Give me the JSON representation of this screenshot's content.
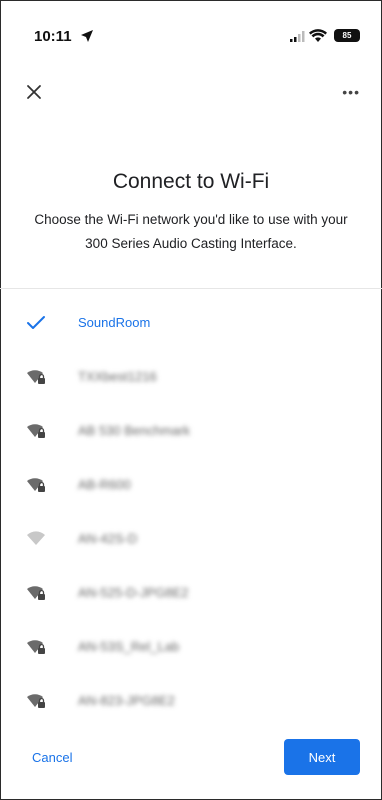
{
  "status_bar": {
    "time": "10:11",
    "battery": "85"
  },
  "header": {
    "title": "Connect to Wi-Fi",
    "subtitle": "Choose the Wi-Fi network you'd like to use with your 300 Series Audio Casting Interface."
  },
  "networks": [
    {
      "name": "SoundRoom",
      "selected": true,
      "icon": "check-icon"
    },
    {
      "name": "TXXbest1216",
      "selected": false,
      "icon": "wifi-locked-icon"
    },
    {
      "name": "AB 530 Benchmark",
      "selected": false,
      "icon": "wifi-locked-icon"
    },
    {
      "name": "AB-R600",
      "selected": false,
      "icon": "wifi-locked-icon"
    },
    {
      "name": "AN-42S-D",
      "selected": false,
      "icon": "wifi-icon"
    },
    {
      "name": "AN-525-D-JPG8E2",
      "selected": false,
      "icon": "wifi-locked-icon"
    },
    {
      "name": "AN-53S_Rel_Lab",
      "selected": false,
      "icon": "wifi-locked-icon"
    },
    {
      "name": "AN-823-JPG8E2",
      "selected": false,
      "icon": "wifi-locked-icon"
    }
  ],
  "footer": {
    "cancel_label": "Cancel",
    "next_label": "Next"
  },
  "colors": {
    "accent": "#1a73e8"
  }
}
